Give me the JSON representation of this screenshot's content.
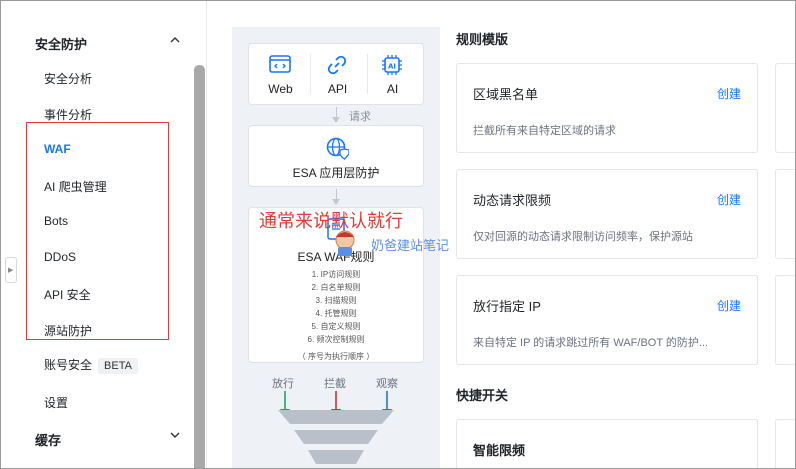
{
  "sidebar": {
    "section1": "安全防护",
    "items": [
      {
        "label": "安全分析"
      },
      {
        "label": "事件分析"
      },
      {
        "label": "WAF"
      },
      {
        "label": "AI 爬虫管理"
      },
      {
        "label": "Bots"
      },
      {
        "label": "DDoS"
      },
      {
        "label": "API 安全"
      },
      {
        "label": "源站防护"
      }
    ],
    "account_security": "账号安全",
    "beta": "BETA",
    "settings": "设置",
    "section2": "缓存"
  },
  "diagram": {
    "top_icons": [
      {
        "label": "Web",
        "icon": "code-window-icon"
      },
      {
        "label": "API",
        "icon": "link-icon"
      },
      {
        "label": "AI",
        "icon": "ai-chip-icon"
      }
    ],
    "request_label": "请求",
    "app_layer_label": "ESA 应用层防护",
    "waf_rules_title": "ESA WAF规则",
    "waf_rules": [
      "1. IP访问规则",
      "2. 白名单规则",
      "3. 扫描规则",
      "4. 托管规则",
      "5. 自定义规则",
      "6. 频次控制规则"
    ],
    "order_note": "（ 序号为执行顺序 ）",
    "outcomes": [
      "放行",
      "拦截",
      "观察"
    ],
    "outcome_colors": [
      "#22a35b",
      "#d92b2b",
      "#2f6fd6"
    ]
  },
  "rules_template": {
    "title": "规则模版",
    "cards": [
      {
        "title": "区域黑名单",
        "action": "创建",
        "desc": "拦截所有来自特定区域的请求"
      },
      {
        "title": "动态请求限频",
        "action": "创建",
        "desc": "仅对回源的动态请求限制访问频率，保护源站"
      },
      {
        "title": "放行指定 IP",
        "action": "创建",
        "desc": "来自特定 IP 的请求跳过所有 WAF/BOT 的防护..."
      }
    ]
  },
  "quick_switch": {
    "title": "快捷开关",
    "card_title": "智能限频"
  },
  "overlay": {
    "annotation": "通常来说默认就行",
    "watermark": "奶爸建站笔记"
  },
  "colors": {
    "accent": "#1677ff",
    "annotation_red": "#e53935"
  }
}
